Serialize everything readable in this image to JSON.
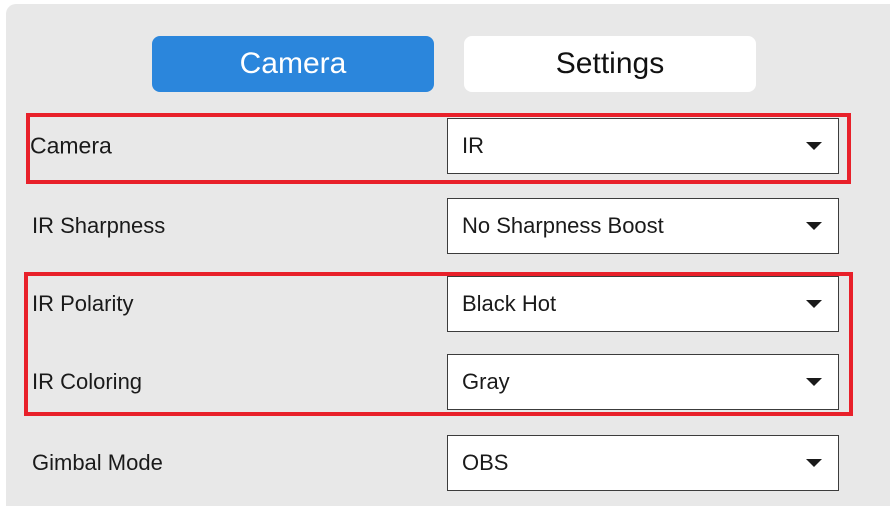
{
  "tabs": {
    "camera_label": "Camera",
    "settings_label": "Settings",
    "active": "Camera"
  },
  "rows": [
    {
      "label": "Camera",
      "value": "IR"
    },
    {
      "label": "IR Sharpness",
      "value": "No Sharpness Boost"
    },
    {
      "label": "IR Polarity",
      "value": "Black Hot"
    },
    {
      "label": "IR Coloring",
      "value": "Gray"
    },
    {
      "label": "Gimbal Mode",
      "value": "OBS"
    }
  ],
  "colors": {
    "accent": "#2b86dc",
    "highlight": "#e8202a",
    "panel_bg": "#e8e8e8"
  },
  "icons": {
    "dropdown": "caret-down-icon"
  }
}
